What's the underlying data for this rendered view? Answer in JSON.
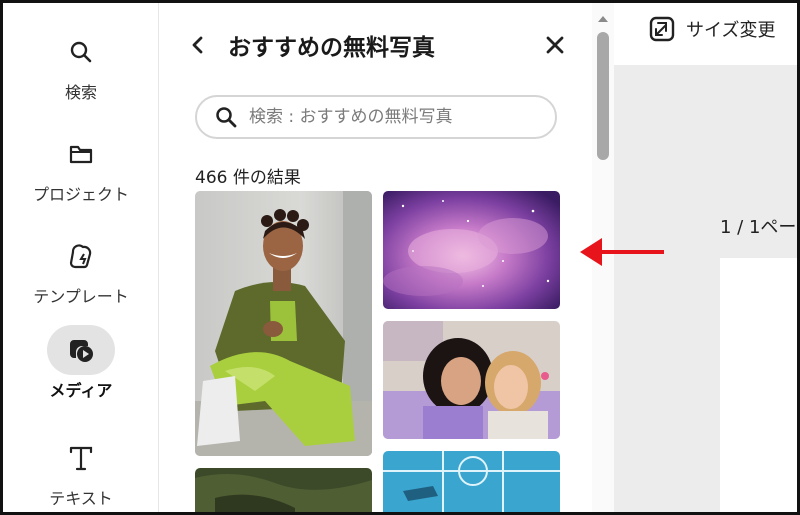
{
  "sidebar": {
    "items": [
      {
        "label": "検索",
        "icon": "search-icon",
        "active": false
      },
      {
        "label": "プロジェクト",
        "icon": "folder-icon",
        "active": false
      },
      {
        "label": "テンプレート",
        "icon": "template-icon",
        "active": false
      },
      {
        "label": "メディア",
        "icon": "media-icon",
        "active": true
      },
      {
        "label": "テキスト",
        "icon": "text-icon",
        "active": false
      }
    ]
  },
  "panel": {
    "title": "おすすめの無料写真",
    "search_placeholder": "検索 : おすすめの無料写真",
    "results_count": "466 件の結果"
  },
  "topbar": {
    "resize_label": "サイズ変更"
  },
  "canvas": {
    "page_indicator": "1 / 1ペー"
  },
  "colors": {
    "accent_red": "#e8141c",
    "active_bg": "#e3e3e3"
  }
}
